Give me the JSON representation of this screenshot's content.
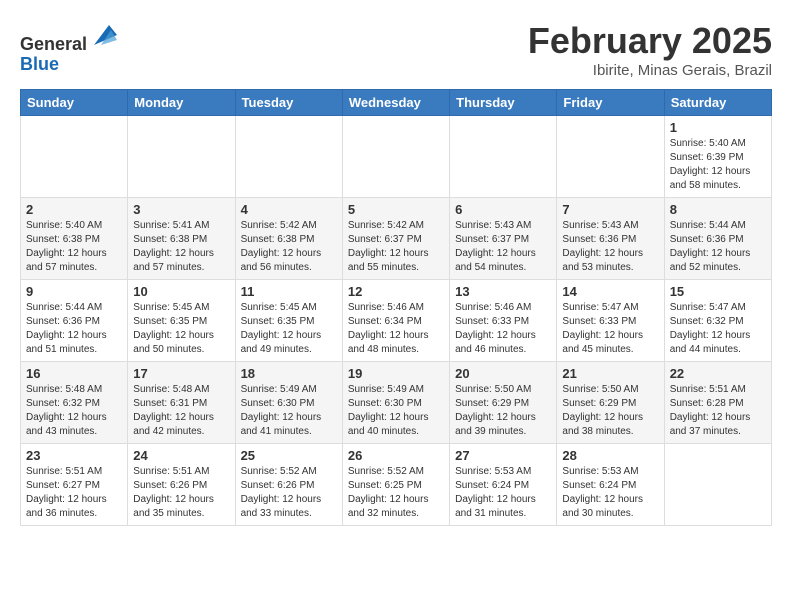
{
  "header": {
    "logo_line1": "General",
    "logo_line2": "Blue",
    "title": "February 2025",
    "subtitle": "Ibirite, Minas Gerais, Brazil"
  },
  "calendar": {
    "days_of_week": [
      "Sunday",
      "Monday",
      "Tuesday",
      "Wednesday",
      "Thursday",
      "Friday",
      "Saturday"
    ],
    "weeks": [
      [
        {
          "day": "",
          "info": ""
        },
        {
          "day": "",
          "info": ""
        },
        {
          "day": "",
          "info": ""
        },
        {
          "day": "",
          "info": ""
        },
        {
          "day": "",
          "info": ""
        },
        {
          "day": "",
          "info": ""
        },
        {
          "day": "1",
          "info": "Sunrise: 5:40 AM\nSunset: 6:39 PM\nDaylight: 12 hours\nand 58 minutes."
        }
      ],
      [
        {
          "day": "2",
          "info": "Sunrise: 5:40 AM\nSunset: 6:38 PM\nDaylight: 12 hours\nand 57 minutes."
        },
        {
          "day": "3",
          "info": "Sunrise: 5:41 AM\nSunset: 6:38 PM\nDaylight: 12 hours\nand 57 minutes."
        },
        {
          "day": "4",
          "info": "Sunrise: 5:42 AM\nSunset: 6:38 PM\nDaylight: 12 hours\nand 56 minutes."
        },
        {
          "day": "5",
          "info": "Sunrise: 5:42 AM\nSunset: 6:37 PM\nDaylight: 12 hours\nand 55 minutes."
        },
        {
          "day": "6",
          "info": "Sunrise: 5:43 AM\nSunset: 6:37 PM\nDaylight: 12 hours\nand 54 minutes."
        },
        {
          "day": "7",
          "info": "Sunrise: 5:43 AM\nSunset: 6:36 PM\nDaylight: 12 hours\nand 53 minutes."
        },
        {
          "day": "8",
          "info": "Sunrise: 5:44 AM\nSunset: 6:36 PM\nDaylight: 12 hours\nand 52 minutes."
        }
      ],
      [
        {
          "day": "9",
          "info": "Sunrise: 5:44 AM\nSunset: 6:36 PM\nDaylight: 12 hours\nand 51 minutes."
        },
        {
          "day": "10",
          "info": "Sunrise: 5:45 AM\nSunset: 6:35 PM\nDaylight: 12 hours\nand 50 minutes."
        },
        {
          "day": "11",
          "info": "Sunrise: 5:45 AM\nSunset: 6:35 PM\nDaylight: 12 hours\nand 49 minutes."
        },
        {
          "day": "12",
          "info": "Sunrise: 5:46 AM\nSunset: 6:34 PM\nDaylight: 12 hours\nand 48 minutes."
        },
        {
          "day": "13",
          "info": "Sunrise: 5:46 AM\nSunset: 6:33 PM\nDaylight: 12 hours\nand 46 minutes."
        },
        {
          "day": "14",
          "info": "Sunrise: 5:47 AM\nSunset: 6:33 PM\nDaylight: 12 hours\nand 45 minutes."
        },
        {
          "day": "15",
          "info": "Sunrise: 5:47 AM\nSunset: 6:32 PM\nDaylight: 12 hours\nand 44 minutes."
        }
      ],
      [
        {
          "day": "16",
          "info": "Sunrise: 5:48 AM\nSunset: 6:32 PM\nDaylight: 12 hours\nand 43 minutes."
        },
        {
          "day": "17",
          "info": "Sunrise: 5:48 AM\nSunset: 6:31 PM\nDaylight: 12 hours\nand 42 minutes."
        },
        {
          "day": "18",
          "info": "Sunrise: 5:49 AM\nSunset: 6:30 PM\nDaylight: 12 hours\nand 41 minutes."
        },
        {
          "day": "19",
          "info": "Sunrise: 5:49 AM\nSunset: 6:30 PM\nDaylight: 12 hours\nand 40 minutes."
        },
        {
          "day": "20",
          "info": "Sunrise: 5:50 AM\nSunset: 6:29 PM\nDaylight: 12 hours\nand 39 minutes."
        },
        {
          "day": "21",
          "info": "Sunrise: 5:50 AM\nSunset: 6:29 PM\nDaylight: 12 hours\nand 38 minutes."
        },
        {
          "day": "22",
          "info": "Sunrise: 5:51 AM\nSunset: 6:28 PM\nDaylight: 12 hours\nand 37 minutes."
        }
      ],
      [
        {
          "day": "23",
          "info": "Sunrise: 5:51 AM\nSunset: 6:27 PM\nDaylight: 12 hours\nand 36 minutes."
        },
        {
          "day": "24",
          "info": "Sunrise: 5:51 AM\nSunset: 6:26 PM\nDaylight: 12 hours\nand 35 minutes."
        },
        {
          "day": "25",
          "info": "Sunrise: 5:52 AM\nSunset: 6:26 PM\nDaylight: 12 hours\nand 33 minutes."
        },
        {
          "day": "26",
          "info": "Sunrise: 5:52 AM\nSunset: 6:25 PM\nDaylight: 12 hours\nand 32 minutes."
        },
        {
          "day": "27",
          "info": "Sunrise: 5:53 AM\nSunset: 6:24 PM\nDaylight: 12 hours\nand 31 minutes."
        },
        {
          "day": "28",
          "info": "Sunrise: 5:53 AM\nSunset: 6:24 PM\nDaylight: 12 hours\nand 30 minutes."
        },
        {
          "day": "",
          "info": ""
        }
      ]
    ]
  }
}
